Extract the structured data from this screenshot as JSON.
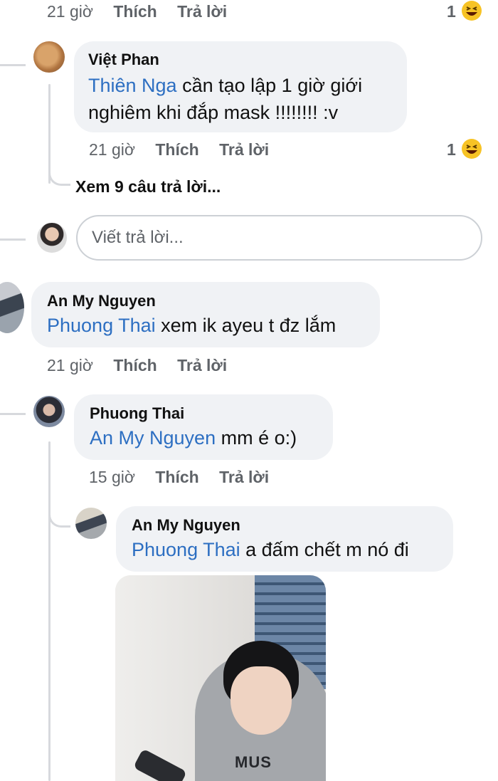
{
  "comments": {
    "top_meta": {
      "time": "21 giờ",
      "like": "Thích",
      "reply": "Trả lời",
      "reaction_count": "1",
      "reaction_icon": "laughing-emoji"
    },
    "viet_phan": {
      "name": "Việt Phan",
      "mention": "Thiên Nga",
      "text_line1": " cần tạo lập 1 giờ giới",
      "text_line2": "nghiêm khi đắp mask !!!!!!!! :v",
      "time": "21 giờ",
      "like": "Thích",
      "reply": "Trả lời",
      "reaction_count": "1",
      "reaction_icon": "laughing-emoji"
    },
    "view_replies": "Xem 9 câu trả lời...",
    "reply_input": {
      "placeholder": "Viết trả lời..."
    },
    "an_my_1": {
      "name": "An My Nguyen",
      "mention": "Phuong Thai",
      "text": " xem ik ayeu t đz lắm",
      "time": "21 giờ",
      "like": "Thích",
      "reply": "Trả lời"
    },
    "phuong_thai": {
      "name": "Phuong Thai",
      "mention": "An My Nguyen",
      "text": " mm é o:)",
      "time": "15 giờ",
      "like": "Thích",
      "reply": "Trả lời"
    },
    "an_my_2": {
      "name": "An My Nguyen",
      "mention": "Phuong Thai",
      "text": " a đấm chết m nó đi",
      "photo_text": "MUS"
    }
  }
}
